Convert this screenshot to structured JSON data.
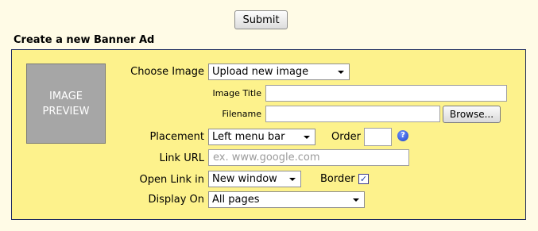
{
  "submit_label": "Submit",
  "section_title": "Create a new Banner Ad",
  "preview": {
    "line1": "IMAGE",
    "line2": "PREVIEW"
  },
  "form": {
    "choose_image": {
      "label": "Choose Image",
      "value": "Upload new image"
    },
    "image_title": {
      "label": "Image Title",
      "value": ""
    },
    "filename": {
      "label": "Filename",
      "value": "",
      "browse_label": "Browse..."
    },
    "placement": {
      "label": "Placement",
      "value": "Left menu bar"
    },
    "order": {
      "label": "Order",
      "value": "",
      "help_icon": "?"
    },
    "link_url": {
      "label": "Link URL",
      "placeholder": "ex. www.google.com"
    },
    "open_link_in": {
      "label": "Open Link in",
      "value": "New window"
    },
    "border": {
      "label": "Border",
      "checked": true,
      "check_glyph": "✓"
    },
    "display_on": {
      "label": "Display On",
      "value": "All pages"
    }
  },
  "colors": {
    "page_bg": "#fffbe6",
    "panel_bg": "#fdf28c",
    "panel_border": "#1d2a5e",
    "preview_bg": "#a6a6a6"
  }
}
